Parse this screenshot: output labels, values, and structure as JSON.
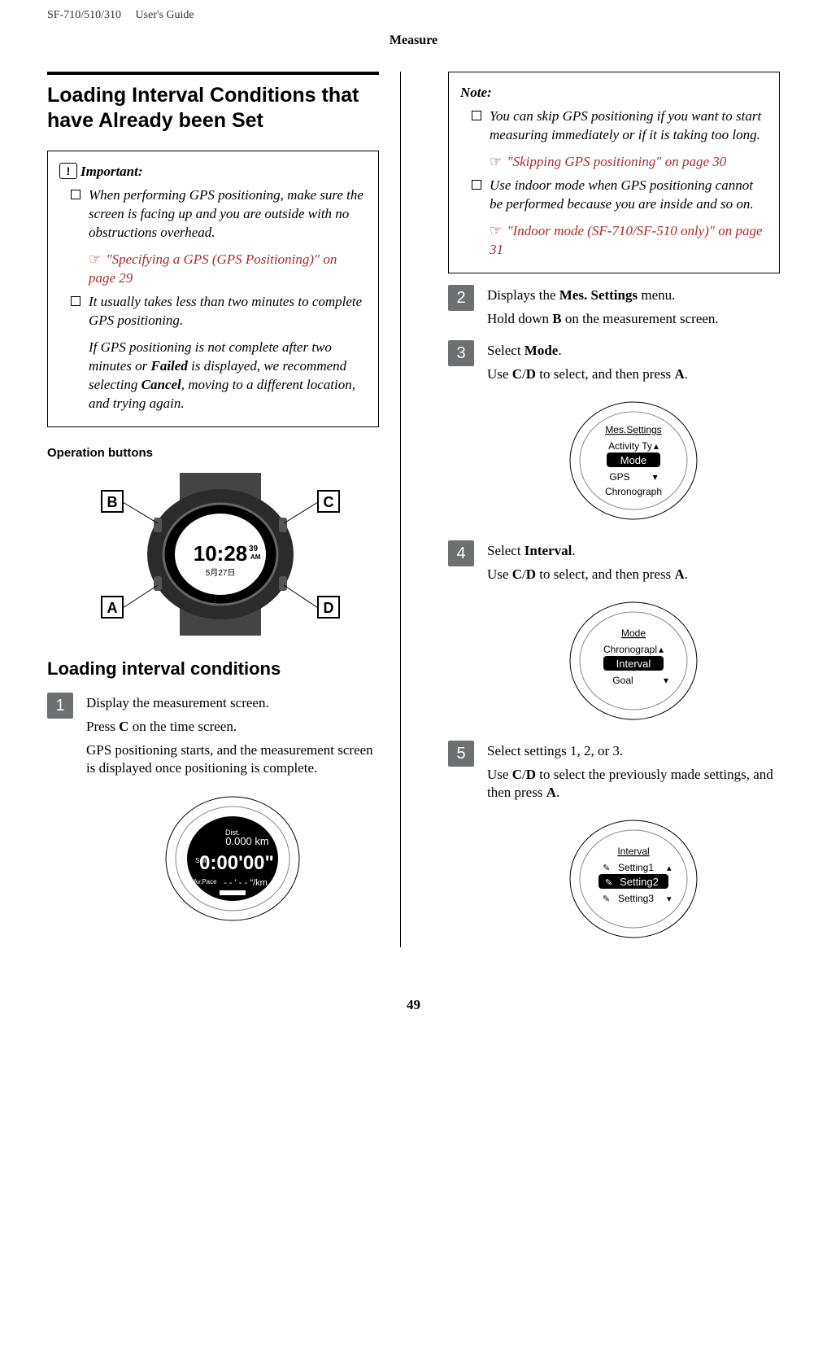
{
  "header": {
    "product": "SF-710/510/310",
    "doc": "User's Guide"
  },
  "sectionTitle": "Measure",
  "left": {
    "h1": "Loading Interval Conditions that have Already been Set",
    "important": {
      "title": "Important:",
      "item1": "When performing GPS positioning, make sure the screen is facing up and you are outside with no obstructions overhead.",
      "ref1": "\"Specifying a GPS (GPS Positioning)\" on page 29",
      "item2": "It usually takes less than two minutes to complete GPS positioning.",
      "sub1a": "If GPS positioning is not complete after two minutes or ",
      "sub1bBold": "Failed",
      "sub1c": " is displayed, we recommend selecting ",
      "sub1dBold": "Cancel",
      "sub1e": ", moving to a different location, and trying again."
    },
    "opButtons": "Operation buttons",
    "h2": "Loading interval conditions",
    "step1": {
      "num": "1",
      "p1": "Display the measurement screen.",
      "p2a": "Press ",
      "p2b": "C",
      "p2c": " on the time screen.",
      "p3": "GPS positioning starts, and the measurement screen is displayed once positioning is complete."
    }
  },
  "right": {
    "note": {
      "title": "Note:",
      "item1": "You can skip GPS positioning if you want to start measuring immediately or if it is taking too long.",
      "ref1": "\"Skipping GPS positioning\" on page 30",
      "item2": "Use indoor mode when GPS positioning cannot be performed because you are inside and so on.",
      "ref2": "\"Indoor mode (SF-710/SF-510 only)\" on page 31"
    },
    "step2": {
      "num": "2",
      "p1a": "Displays the ",
      "p1b": "Mes. Settings",
      "p1c": " menu.",
      "p2a": "Hold down ",
      "p2b": "B",
      "p2c": " on the measurement screen."
    },
    "step3": {
      "num": "3",
      "p1a": "Select ",
      "p1b": "Mode",
      "p1c": ".",
      "p2a": "Use ",
      "p2b": "C",
      "p2c": "/",
      "p2d": "D",
      "p2e": " to select, and then press ",
      "p2f": "A",
      "p2g": ".",
      "screen": {
        "title": "Mes.Settings",
        "l1": "Activity Ty",
        "sel": "Mode",
        "l2": "GPS",
        "l3": "Chronograph"
      }
    },
    "step4": {
      "num": "4",
      "p1a": "Select ",
      "p1b": "Interval",
      "p1c": ".",
      "p2a": "Use ",
      "p2b": "C",
      "p2c": "/",
      "p2d": "D",
      "p2e": " to select, and then press ",
      "p2f": "A",
      "p2g": ".",
      "screen": {
        "title": "Mode",
        "l1": "Chronograpl",
        "sel": "Interval",
        "l2": "Goal"
      }
    },
    "step5": {
      "num": "5",
      "p1": "Select settings 1, 2, or 3.",
      "p2a": "Use ",
      "p2b": "C",
      "p2c": "/",
      "p2d": "D",
      "p2e": " to select the previously made settings, and then press ",
      "p2f": "A",
      "p2g": ".",
      "screen": {
        "title": "Interval",
        "l1": "Setting1",
        "sel": "Setting2",
        "l2": "Setting3"
      }
    }
  },
  "pageNumber": "49"
}
